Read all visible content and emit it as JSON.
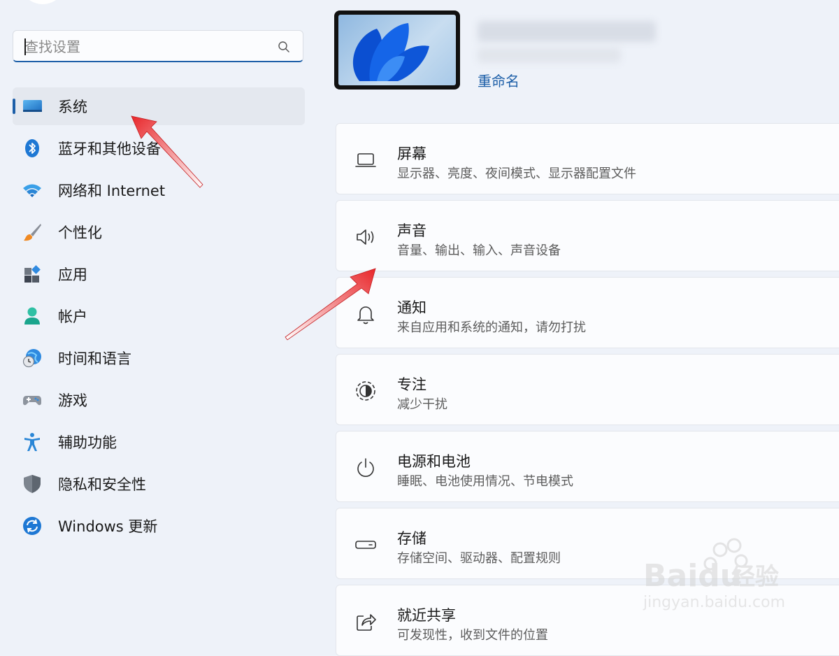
{
  "search": {
    "placeholder": "查找设置"
  },
  "nav": {
    "items": [
      {
        "label": "系统",
        "icon": "monitor-icon",
        "active": true
      },
      {
        "label": "蓝牙和其他设备",
        "icon": "bluetooth-icon"
      },
      {
        "label": "网络和 Internet",
        "icon": "wifi-icon"
      },
      {
        "label": "个性化",
        "icon": "brush-icon"
      },
      {
        "label": "应用",
        "icon": "apps-icon"
      },
      {
        "label": "帐户",
        "icon": "user-icon"
      },
      {
        "label": "时间和语言",
        "icon": "globe-clock-icon"
      },
      {
        "label": "游戏",
        "icon": "gamepad-icon"
      },
      {
        "label": "辅助功能",
        "icon": "accessibility-icon"
      },
      {
        "label": "隐私和安全性",
        "icon": "shield-icon"
      },
      {
        "label": "Windows 更新",
        "icon": "update-icon"
      }
    ]
  },
  "device": {
    "rename_label": "重命名"
  },
  "settings_cards": [
    {
      "title": "屏幕",
      "subtitle": "显示器、亮度、夜间模式、显示器配置文件",
      "icon": "laptop-icon"
    },
    {
      "title": "声音",
      "subtitle": "音量、输出、输入、声音设备",
      "icon": "speaker-icon"
    },
    {
      "title": "通知",
      "subtitle": "来自应用和系统的通知，请勿打扰",
      "icon": "bell-icon"
    },
    {
      "title": "专注",
      "subtitle": "减少干扰",
      "icon": "focus-icon"
    },
    {
      "title": "电源和电池",
      "subtitle": "睡眠、电池使用情况、节电模式",
      "icon": "power-icon"
    },
    {
      "title": "存储",
      "subtitle": "存储空间、驱动器、配置规则",
      "icon": "storage-icon"
    },
    {
      "title": "就近共享",
      "subtitle": "可发现性，收到文件的位置",
      "icon": "share-icon"
    }
  ],
  "watermark": {
    "brand": "Baidu",
    "cn": "经验",
    "url": "jingyan.baidu.com"
  },
  "colors": {
    "accent": "#1d5fa8",
    "arrow": "#e8262a"
  }
}
